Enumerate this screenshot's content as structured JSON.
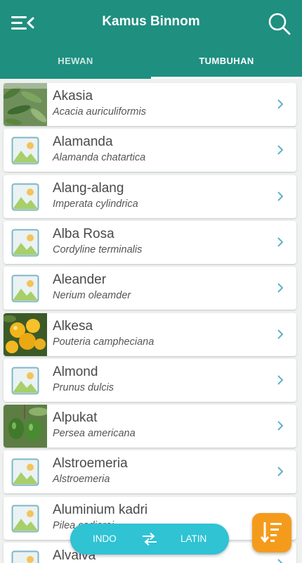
{
  "header": {
    "title": "Kamus Binnom",
    "menu_icon": "menu-back-icon",
    "search_icon": "search-icon"
  },
  "tabs": [
    {
      "label": "HEWAN",
      "active": false
    },
    {
      "label": "TUMBUHAN",
      "active": true
    }
  ],
  "items": [
    {
      "name": "Akasia",
      "latin": "Acacia auriculiformis",
      "thumb": "photo-leaves"
    },
    {
      "name": "Alamanda",
      "latin": "Alamanda chatartica",
      "thumb": "image-placeholder-icon"
    },
    {
      "name": "Alang-alang",
      "latin": "Imperata cylindrica",
      "thumb": "image-placeholder-icon"
    },
    {
      "name": "Alba Rosa",
      "latin": "Cordyline terminalis",
      "thumb": "image-placeholder-icon"
    },
    {
      "name": "Aleander",
      "latin": "Nerium oleamder",
      "thumb": "image-placeholder-icon"
    },
    {
      "name": "Alkesa",
      "latin": "Pouteria campheciana",
      "thumb": "photo-yellow-fruit"
    },
    {
      "name": "Almond",
      "latin": "Prunus dulcis",
      "thumb": "image-placeholder-icon"
    },
    {
      "name": "Alpukat",
      "latin": "Persea americana",
      "thumb": "photo-avocado"
    },
    {
      "name": "Alstroemeria",
      "latin": "Alstroemeria",
      "thumb": "image-placeholder-icon"
    },
    {
      "name": "Aluminium kadri",
      "latin": "Pilea cadierei",
      "thumb": "image-placeholder-icon"
    },
    {
      "name": "Alvaiva",
      "latin": "",
      "thumb": "image-placeholder-icon"
    }
  ],
  "language_toggle": {
    "left": "INDO",
    "right": "LATIN",
    "swap_icon": "swap-arrows-icon"
  },
  "sort_button": {
    "icon": "sort-descending-icon"
  },
  "colors": {
    "primary": "#1f8f80",
    "accent": "#2fc3d4",
    "fab": "#f59b1c",
    "chevron": "#5fb3c6"
  }
}
